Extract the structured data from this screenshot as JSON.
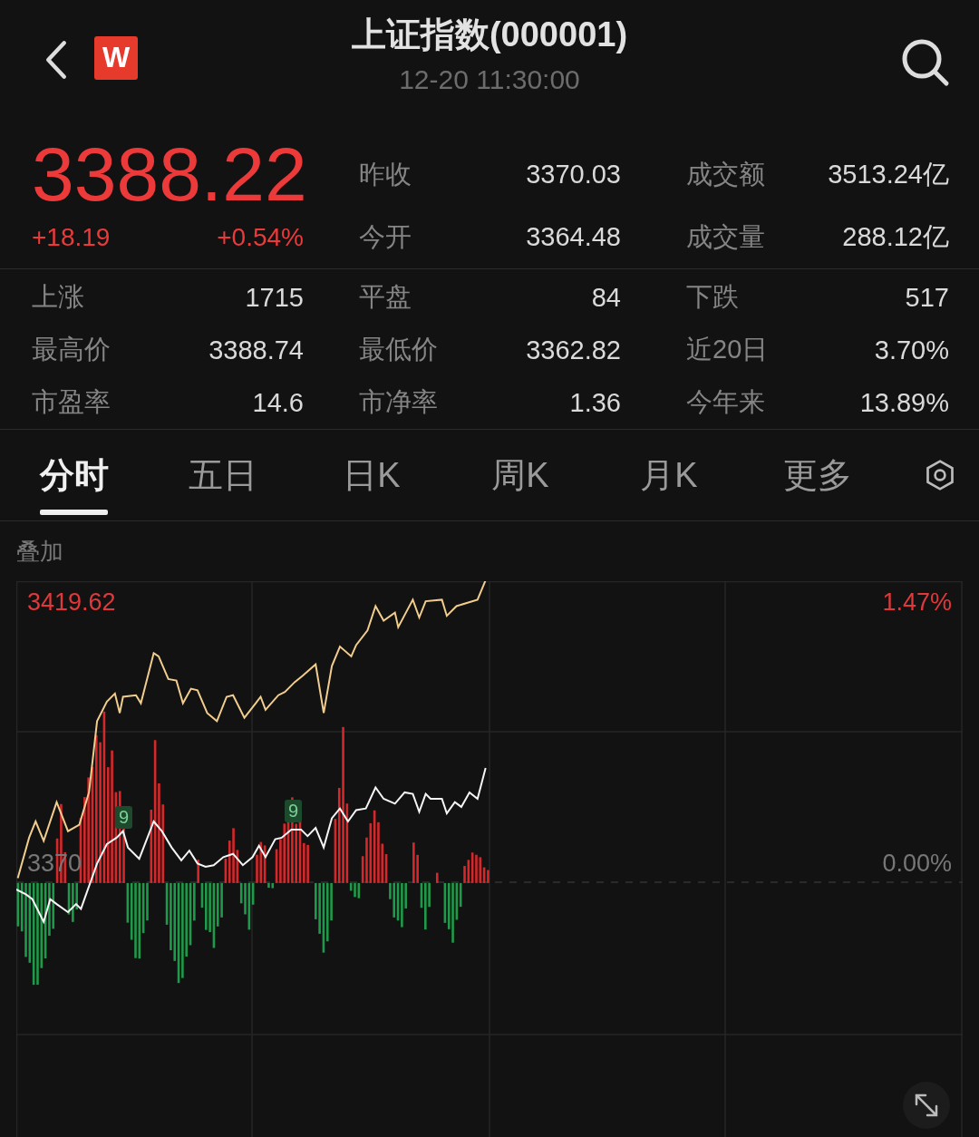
{
  "header": {
    "logo": "W",
    "title": "上证指数(000001)",
    "time": "12-20 11:30:00"
  },
  "quote": {
    "price": "3388.22",
    "change": "+18.19",
    "change_pct": "+0.54%"
  },
  "top_stats": [
    {
      "label": "昨收",
      "value": "3370.03"
    },
    {
      "label": "成交额",
      "value": "3513.24亿"
    },
    {
      "label": "今开",
      "value": "3364.48"
    },
    {
      "label": "成交量",
      "value": "288.12亿"
    }
  ],
  "stats": [
    {
      "label": "上涨",
      "value": "1715"
    },
    {
      "label": "平盘",
      "value": "84"
    },
    {
      "label": "下跌",
      "value": "517"
    },
    {
      "label": "最高价",
      "value": "3388.74"
    },
    {
      "label": "最低价",
      "value": "3362.82"
    },
    {
      "label": "近20日",
      "value": "3.70%"
    },
    {
      "label": "市盈率",
      "value": "14.6"
    },
    {
      "label": "市净率",
      "value": "1.36"
    },
    {
      "label": "今年来",
      "value": "13.89%"
    }
  ],
  "tabs": [
    {
      "label": "分时",
      "selected": true
    },
    {
      "label": "五日",
      "selected": false
    },
    {
      "label": "日K",
      "selected": false
    },
    {
      "label": "周K",
      "selected": false
    },
    {
      "label": "月K",
      "selected": false
    },
    {
      "label": "更多",
      "selected": false
    }
  ],
  "overlay_label": "叠加",
  "chart": {
    "top_price": "3419.62",
    "base_price": "3370",
    "top_pct": "1.47%",
    "base_pct": "0.00%",
    "markers": [
      "9",
      "9"
    ]
  }
}
